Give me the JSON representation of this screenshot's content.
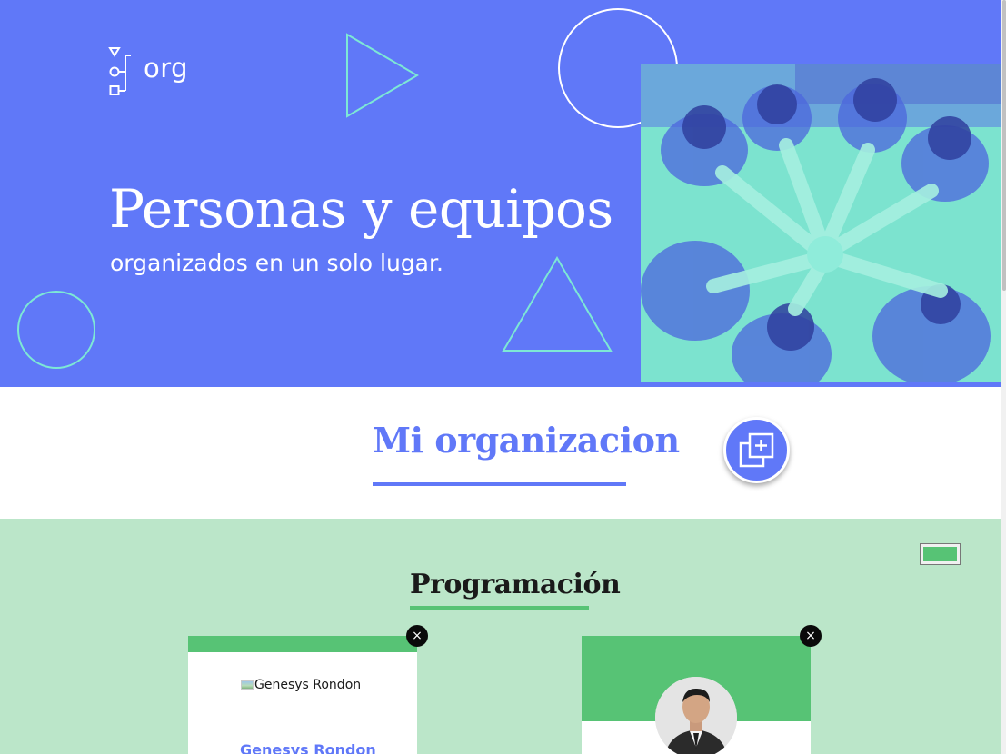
{
  "hero": {
    "logo_text": "org",
    "title": "Personas y equipos",
    "subtitle": "organizados en un solo lugar."
  },
  "organization": {
    "title": "Mi organizacion",
    "add_button_icon": "add-team-icon"
  },
  "team": {
    "title": "Programación",
    "color_picker_value": "#57c375",
    "members": [
      {
        "image_alt": "Genesys Rondon",
        "name": "Genesys Rondon",
        "close_label": "×"
      },
      {
        "close_label": "×"
      }
    ]
  },
  "colors": {
    "primary": "#6078f8",
    "secondary": "#57c375",
    "team_bg": "#bbe6c9",
    "accent_outline": "#7de8d5"
  }
}
